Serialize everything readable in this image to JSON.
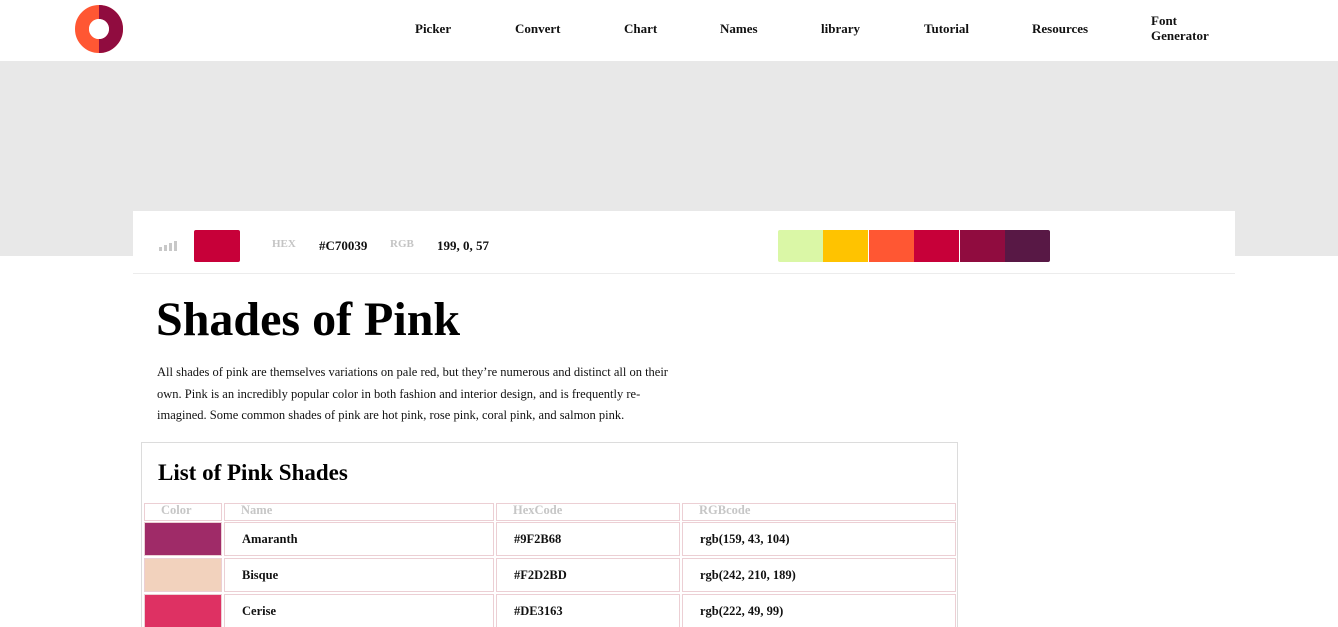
{
  "nav": {
    "items": [
      "Picker",
      "Convert",
      "Chart",
      "Names",
      "library",
      "Tutorial",
      "Resources",
      "Font Generator"
    ]
  },
  "colors": {
    "logo_outer": "#FF5733",
    "logo_inner": "#900C3F",
    "ad_band": "#E8E8E8",
    "accent": "#C70039"
  },
  "icons": {
    "logo": "donut-logo-icon",
    "signal": "signal-bars-icon"
  },
  "color_bar": {
    "current_color": "#C70039",
    "hex_label": "HEX",
    "hex_value": "#C70039",
    "rgb_label": "RGB",
    "rgb_value": "199, 0, 57",
    "palette": [
      "#DAF7A6",
      "#FFC300",
      "#FF5733",
      "#C70039",
      "#900C3F",
      "#581845"
    ]
  },
  "page": {
    "title": "Shades of Pink",
    "intro": "All shades of pink are themselves variations on pale red, but they’re numerous and distinct all on their own. Pink is an incredibly popular color in both fashion and interior design, and is frequently re-imagined. Some common shades of pink are hot pink, rose pink, coral pink, and salmon pink."
  },
  "list": {
    "title": "List of Pink Shades",
    "headers": [
      "Color",
      "Name",
      "HexCode",
      "RGBcode"
    ],
    "rows": [
      {
        "name": "Amaranth",
        "hex": "#9F2B68",
        "rgb": "rgb(159, 43, 104)",
        "color": "#9F2B68"
      },
      {
        "name": "Bisque",
        "hex": "#F2D2BD",
        "rgb": "rgb(242, 210, 189)",
        "color": "#F2D2BD"
      },
      {
        "name": "Cerise",
        "hex": "#DE3163",
        "rgb": "rgb(222, 49, 99)",
        "color": "#DE3163"
      }
    ]
  }
}
